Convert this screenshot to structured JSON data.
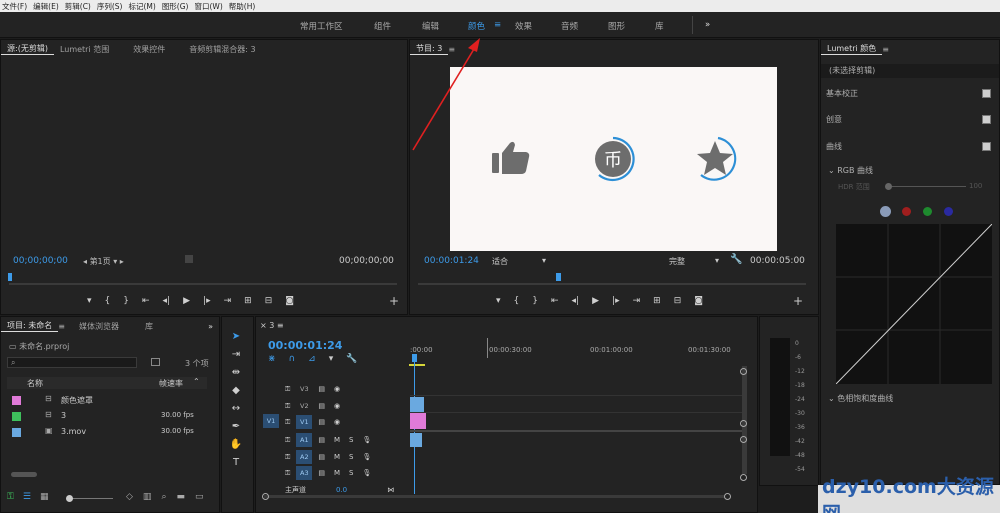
{
  "menu": [
    "文件(F)",
    "编辑(E)",
    "剪辑(C)",
    "序列(S)",
    "标记(M)",
    "图形(G)",
    "窗口(W)",
    "帮助(H)"
  ],
  "workspaces": [
    "常用工作区",
    "组件",
    "编辑",
    "颜色",
    "效果",
    "音频",
    "图形",
    "库"
  ],
  "workspace_active": "颜色",
  "workspace_more": "»",
  "source_panel": {
    "tabs": [
      "源:(无剪辑)",
      "Lumetri 范围",
      "效果控件",
      "音频剪辑混合器: 3"
    ],
    "timecode_left": "00;00;00;00",
    "page": "第1页",
    "timecode_right": "00;00;00;00"
  },
  "program_panel": {
    "title": "节目: 3",
    "timecode_left": "00:00:01:24",
    "fit": "适合",
    "quality": "完整",
    "timecode_right": "00:00:05:00"
  },
  "lumetri": {
    "title": "Lumetri 颜色",
    "clip": "(未选择剪辑)",
    "sections": [
      "基本校正",
      "创意",
      "曲线"
    ],
    "rgb_curve": "RGB 曲线",
    "hdr_label": "HDR 范围",
    "hdr_value": "100",
    "hue_sat": "色相饱和度曲线",
    "channel_colors": [
      "#8a9bb8",
      "#a01e1e",
      "#1e8a2e",
      "#2a2aa0"
    ]
  },
  "project": {
    "tabs": [
      "项目: 未命名",
      "媒体浏览器",
      "库"
    ],
    "file": "未命名.prproj",
    "count": "3 个项",
    "col_name": "名称",
    "col_fps": "帧速率",
    "items": [
      {
        "name": "颜色遮罩",
        "fps": "",
        "color": "#e07ad8"
      },
      {
        "name": "3",
        "fps": "30.00 fps",
        "color": "#3ec05c"
      },
      {
        "name": "3.mov",
        "fps": "30.00 fps",
        "color": "#6aa9e0"
      }
    ]
  },
  "timeline": {
    "seq": "3",
    "timecode": "00:00:01:24",
    "ruler": [
      ":00:00",
      "00:00:30:00",
      "00:01:00:00",
      "00:01:30:00"
    ],
    "video_tracks": [
      "V3",
      "V2",
      "V1"
    ],
    "audio_tracks": [
      "A1",
      "A2",
      "A3"
    ],
    "source_v": "V1",
    "source_a": "A1",
    "master": "主声道",
    "master_val": "0.0"
  },
  "meter_scale": [
    "0",
    "-6",
    "-12",
    "-18",
    "-24",
    "-30",
    "-36",
    "-42",
    "-48",
    "-54"
  ],
  "watermark": "dzy10.com大资源网"
}
